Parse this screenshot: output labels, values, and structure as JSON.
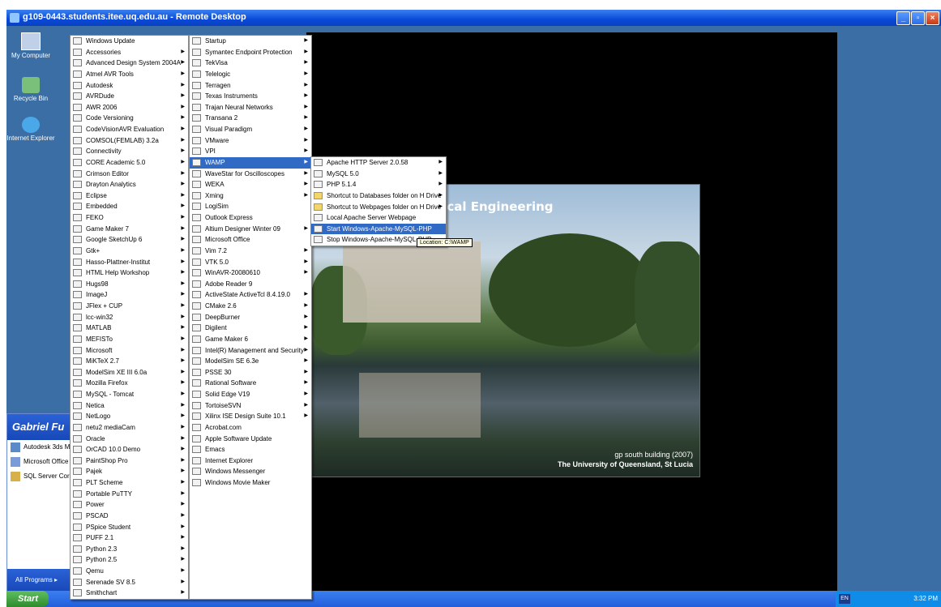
{
  "window": {
    "title": "g109-0443.students.itee.uq.edu.au - Remote Desktop"
  },
  "desktop_icons": [
    {
      "label": "My Computer",
      "icon": "my-computer-icon"
    },
    {
      "label": "Recycle Bin",
      "icon": "recycle-bin-icon"
    },
    {
      "label": "Internet Explorer",
      "icon": "internet-explorer-icon"
    }
  ],
  "wallpaper": {
    "title": "echnology & Electrical Engineering",
    "caption1": "gp south building (2007)",
    "caption2": "The University of Queensland, St Lucia"
  },
  "start_panel": {
    "user": "Gabriel Fu",
    "pinned": [
      "Autodesk 3ds M",
      "Microsoft Office",
      "SQL Server Cor"
    ],
    "all_programs": "All Programs"
  },
  "taskbar": {
    "start": "Start",
    "lang": "EN",
    "clock": "3:32 PM"
  },
  "menu1": [
    {
      "label": "Windows Update"
    },
    {
      "label": "Accessories"
    },
    {
      "label": "Advanced Design System 2004A"
    },
    {
      "label": "Atmel AVR Tools"
    },
    {
      "label": "Autodesk"
    },
    {
      "label": "AVRDude"
    },
    {
      "label": "AWR 2006"
    },
    {
      "label": "Code Versioning"
    },
    {
      "label": "CodeVisionAVR Evaluation"
    },
    {
      "label": "COMSOL(FEMLAB) 3.2a"
    },
    {
      "label": "Connectivity"
    },
    {
      "label": "CORE Academic 5.0"
    },
    {
      "label": "Crimson Editor"
    },
    {
      "label": "Drayton Analytics"
    },
    {
      "label": "Eclipse"
    },
    {
      "label": "Embedded"
    },
    {
      "label": "FEKO"
    },
    {
      "label": "Game Maker 7"
    },
    {
      "label": "Google SketchUp 6"
    },
    {
      "label": "Gtk+"
    },
    {
      "label": "Hasso-Plattner-Institut"
    },
    {
      "label": "HTML Help Workshop"
    },
    {
      "label": "Hugs98"
    },
    {
      "label": "ImageJ"
    },
    {
      "label": "JFlex + CUP"
    },
    {
      "label": "lcc-win32"
    },
    {
      "label": "MATLAB"
    },
    {
      "label": "MEFISTo"
    },
    {
      "label": "Microsoft"
    },
    {
      "label": "MiKTeX 2.7"
    },
    {
      "label": "ModelSim XE III 6.0a"
    },
    {
      "label": "Mozilla Firefox"
    },
    {
      "label": "MySQL - Tomcat"
    },
    {
      "label": "Netica"
    },
    {
      "label": "NetLogo"
    },
    {
      "label": "netu2 mediaCam"
    },
    {
      "label": "Oracle"
    },
    {
      "label": "OrCAD 10.0 Demo"
    },
    {
      "label": "PaintShop Pro"
    },
    {
      "label": "Pajek"
    },
    {
      "label": "PLT Scheme"
    },
    {
      "label": "Portable PuTTY"
    },
    {
      "label": "Power"
    },
    {
      "label": "PSCAD"
    },
    {
      "label": "PSpice Student"
    },
    {
      "label": "PUFF 2.1"
    },
    {
      "label": "Python 2.3"
    },
    {
      "label": "Python 2.5"
    },
    {
      "label": "Qemu"
    },
    {
      "label": "Serenade SV 8.5"
    },
    {
      "label": "Smithchart"
    }
  ],
  "menu2": [
    {
      "label": "Startup"
    },
    {
      "label": "Symantec Endpoint Protection"
    },
    {
      "label": "TekVisa"
    },
    {
      "label": "Telelogic"
    },
    {
      "label": "Terragen"
    },
    {
      "label": "Texas Instruments"
    },
    {
      "label": "Trajan Neural Networks"
    },
    {
      "label": "Transana 2"
    },
    {
      "label": "Visual Paradigm"
    },
    {
      "label": "VMware"
    },
    {
      "label": "VPI"
    },
    {
      "label": "WAMP"
    },
    {
      "label": "WaveStar for Oscilloscopes"
    },
    {
      "label": "WEKA"
    },
    {
      "label": "Xming"
    },
    {
      "label": "LogiSim"
    },
    {
      "label": "Outlook Express"
    },
    {
      "label": "Altium Designer Winter 09"
    },
    {
      "label": "Microsoft Office"
    },
    {
      "label": "Vim 7.2"
    },
    {
      "label": "VTK 5.0"
    },
    {
      "label": "WinAVR-20080610"
    },
    {
      "label": "Adobe Reader 9"
    },
    {
      "label": "ActiveState ActiveTcl 8.4.19.0"
    },
    {
      "label": "CMake 2.6"
    },
    {
      "label": "DeepBurner"
    },
    {
      "label": "Digilent"
    },
    {
      "label": "Game Maker 6"
    },
    {
      "label": "Intel(R) Management and Security"
    },
    {
      "label": "ModelSim SE 6.3e"
    },
    {
      "label": "PSSE 30"
    },
    {
      "label": "Rational Software"
    },
    {
      "label": "Solid Edge V19"
    },
    {
      "label": "TortoiseSVN"
    },
    {
      "label": "Xilinx ISE Design Suite 10.1"
    },
    {
      "label": "Acrobat.com"
    },
    {
      "label": "Apple Software Update"
    },
    {
      "label": "Emacs"
    },
    {
      "label": "Internet Explorer"
    },
    {
      "label": "Windows Messenger"
    },
    {
      "label": "Windows Movie Maker"
    },
    {
      "label": ""
    },
    {
      "label": ""
    },
    {
      "label": ""
    },
    {
      "label": ""
    },
    {
      "label": ""
    },
    {
      "label": ""
    },
    {
      "label": ""
    },
    {
      "label": ""
    },
    {
      "label": ""
    },
    {
      "label": ""
    }
  ],
  "menu3": [
    {
      "label": "Apache HTTP Server 2.0.58"
    },
    {
      "label": "MySQL 5.0"
    },
    {
      "label": "PHP 5.1.4"
    },
    {
      "label": "Shortcut to Databases folder on H Drive"
    },
    {
      "label": "Shortcut to Webpages folder on H Drive"
    },
    {
      "label": "Local Apache Server Webpage"
    },
    {
      "label": "Start Windows-Apache-MySQL-PHP"
    },
    {
      "label": "Stop Windows-Apache-MySQL-PHP"
    }
  ],
  "tooltip": "Location: C:\\WAMP"
}
